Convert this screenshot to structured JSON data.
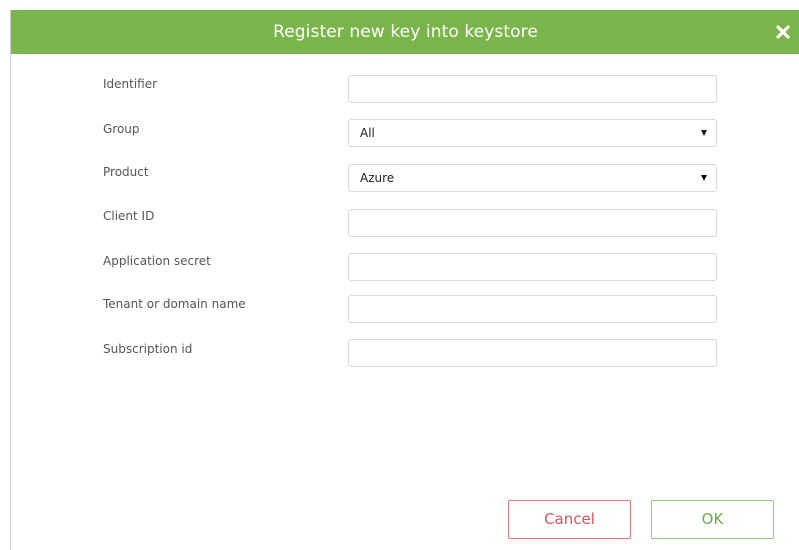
{
  "dialog": {
    "title": "Register new key into keystore",
    "close_icon": "close-icon",
    "colors": {
      "header_bg": "#79b54a",
      "cancel_border": "#e6777c",
      "cancel_text": "#d4545a",
      "ok_border": "#92c973",
      "ok_text": "#6cac45"
    }
  },
  "form": {
    "identifier": {
      "label": "Identifier",
      "value": ""
    },
    "group": {
      "label": "Group",
      "selected": "All"
    },
    "product": {
      "label": "Product",
      "selected": "Azure"
    },
    "client_id": {
      "label": "Client ID",
      "value": ""
    },
    "application_secret": {
      "label": "Application secret",
      "value": ""
    },
    "tenant": {
      "label": "Tenant or domain name",
      "value": ""
    },
    "subscription_id": {
      "label": "Subscription id",
      "value": ""
    }
  },
  "buttons": {
    "cancel_label": "Cancel",
    "ok_label": "OK"
  }
}
